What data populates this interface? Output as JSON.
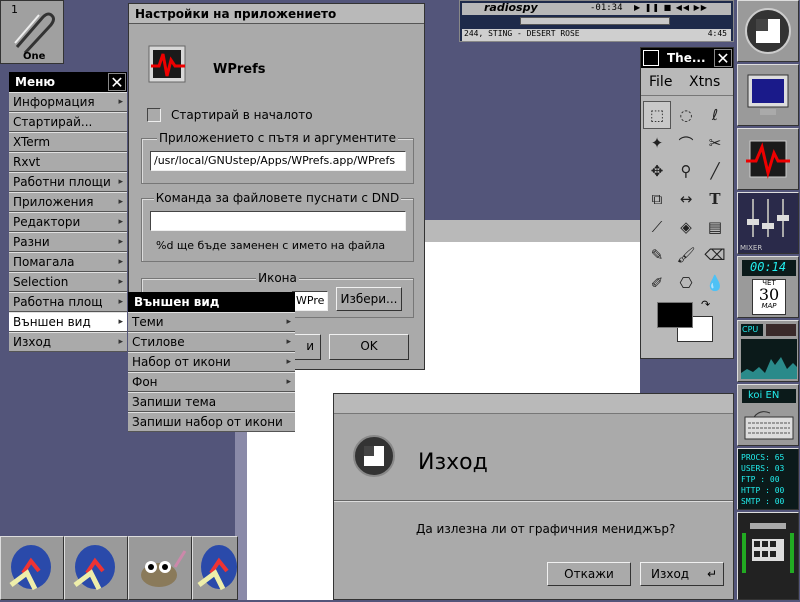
{
  "workspace_tile": {
    "number": "1",
    "name": "One"
  },
  "main_menu": {
    "title": "Меню",
    "items": [
      {
        "label": "Информация",
        "arrow": true
      },
      {
        "label": "Стартирай...",
        "arrow": false
      },
      {
        "label": "XTerm",
        "arrow": false
      },
      {
        "label": "Rxvt",
        "arrow": false
      },
      {
        "label": "Работни площи",
        "arrow": true
      },
      {
        "label": "Приложения",
        "arrow": true
      },
      {
        "label": "Редактори",
        "arrow": true
      },
      {
        "label": "Разни",
        "arrow": true
      },
      {
        "label": "Помагала",
        "arrow": true
      },
      {
        "label": "Selection",
        "arrow": true
      },
      {
        "label": "Работна площ",
        "arrow": true
      },
      {
        "label": "Външен вид",
        "arrow": true
      },
      {
        "label": "Изход",
        "arrow": true
      }
    ]
  },
  "appearance_menu": {
    "title": "Външен вид",
    "items": [
      {
        "label": "Теми",
        "arrow": true
      },
      {
        "label": "Стилове",
        "arrow": true
      },
      {
        "label": "Набор от икони",
        "arrow": true
      },
      {
        "label": "Фон",
        "arrow": true
      },
      {
        "label": "Запиши тема",
        "arrow": false
      },
      {
        "label": "Запиши набор от икони",
        "arrow": false
      }
    ]
  },
  "settings_window": {
    "title": "Настройки на приложението",
    "app_name": "WPrefs",
    "startup_checkbox": "Стартирай в началото",
    "path_group_title": "Приложението с пътя и аргументите",
    "path_value": "/usr/local/GNUstep/Apps/WPrefs.app/WPrefs",
    "dnd_group_title": "Команда за файловете пуснати с DND",
    "dnd_value": "",
    "dnd_hint": "%d ще бъде заменен с името на файла",
    "icon_group_title": "Икона",
    "icon_value": "WPre",
    "browse_button": "Избери...",
    "cancel_button_partial": "и",
    "ok_button": "OK"
  },
  "radio_player": {
    "brand": "radiospy",
    "time": "-01:34",
    "track": "244, STING - DESERT ROSE",
    "duration": "4:45"
  },
  "paint_tools": {
    "title": "The...",
    "menu_file": "File",
    "menu_xtns": "Xtns"
  },
  "exit_dialog": {
    "title": "Изход",
    "question": "Да излезна ли от графичния мениджър?",
    "cancel_button": "Откажи",
    "exit_button": "Изход"
  },
  "dock": {
    "clock_time": "00:14",
    "calendar_day": "ЧЕТ",
    "calendar_date": "30",
    "calendar_month": "МАР",
    "cpu_label": "CPU",
    "keyboard_layout": "koi EN",
    "mixer_label": "MIXER",
    "stats": [
      "PROCS: 65",
      "USERS: 03",
      "FTP  : 00",
      "HTTP : 00",
      "SMTP : 00"
    ]
  }
}
